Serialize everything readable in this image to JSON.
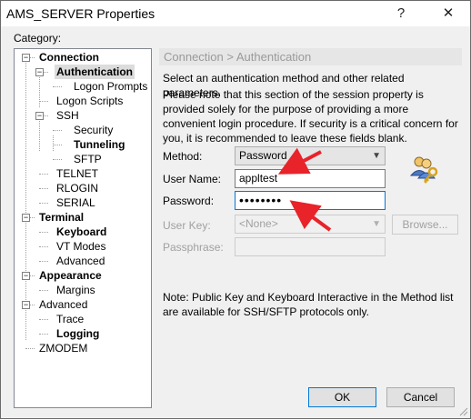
{
  "window": {
    "title": "AMS_SERVER Properties",
    "help_label": "?",
    "close_label": "✕"
  },
  "category_label": "Category:",
  "tree": [
    {
      "label": "Connection",
      "bold": true,
      "sym": "−"
    },
    {
      "label": "Authentication",
      "bold": true,
      "selected": true,
      "sym": "−"
    },
    {
      "label": "Logon Prompts"
    },
    {
      "label": "Logon Scripts"
    },
    {
      "label": "SSH",
      "sym": "−"
    },
    {
      "label": "Security"
    },
    {
      "label": "Tunneling",
      "bold": true
    },
    {
      "label": "SFTP"
    },
    {
      "label": "TELNET"
    },
    {
      "label": "RLOGIN"
    },
    {
      "label": "SERIAL"
    },
    {
      "label": "Terminal",
      "bold": true,
      "sym": "−"
    },
    {
      "label": "Keyboard",
      "bold": true
    },
    {
      "label": "VT Modes"
    },
    {
      "label": "Advanced"
    },
    {
      "label": "Appearance",
      "bold": true,
      "sym": "−"
    },
    {
      "label": "Margins"
    },
    {
      "label": "Advanced",
      "sym": "−"
    },
    {
      "label": "Trace"
    },
    {
      "label": "Logging",
      "bold": true
    },
    {
      "label": "ZMODEM"
    }
  ],
  "main": {
    "breadcrumb": "Connection > Authentication",
    "intro": "Select an authentication method and other related parameters.",
    "note1": "Please note that this section of the session property is provided solely for the purpose of providing a more convenient login procedure. If security is a critical concern for you, it is recommended to leave these fields blank.",
    "method_label": "Method:",
    "method_value": "Password",
    "username_label": "User Name:",
    "username_value": "appltest",
    "password_label": "Password:",
    "password_value": "••••••••",
    "userkey_label": "User Key:",
    "userkey_value": "<None>",
    "browse_label": "Browse...",
    "passphrase_label": "Passphrase:",
    "note2": "Note: Public Key and Keyboard Interactive in the Method list are available for SSH/SFTP protocols only."
  },
  "buttons": {
    "ok": "OK",
    "cancel": "Cancel"
  },
  "colors": {
    "annotation_arrow": "#e8232a",
    "focus_border": "#0078d7"
  }
}
